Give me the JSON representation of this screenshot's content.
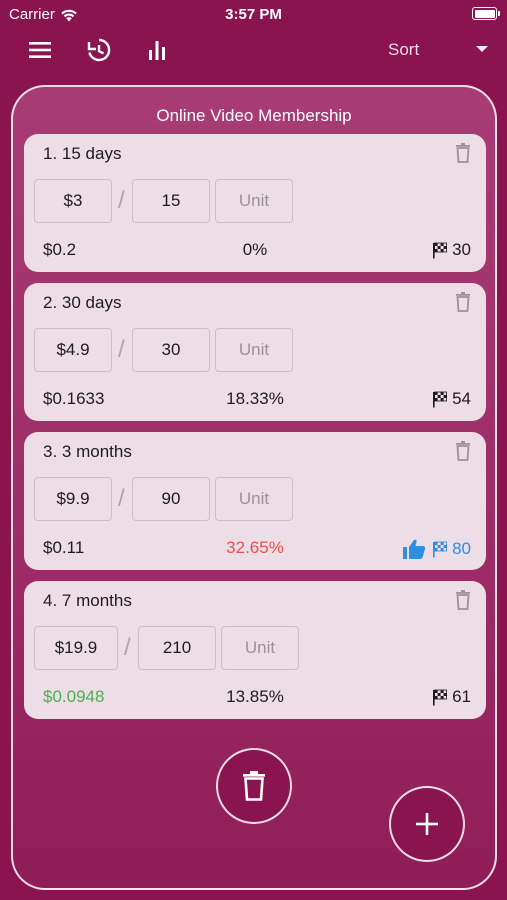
{
  "status_bar": {
    "carrier": "Carrier",
    "time": "3:57 PM"
  },
  "toolbar": {
    "menu_icon": "menu-icon",
    "history_icon": "history-icon",
    "chart_icon": "bar-chart-icon",
    "sort_label": "Sort"
  },
  "panel": {
    "title": "Online Video Membership",
    "items": [
      {
        "title": "1. 15 days",
        "price": "$3",
        "quantity": "15",
        "unit_placeholder": "Unit",
        "per_unit": "$0.2",
        "percent": "0%",
        "score": "30",
        "recommended": false
      },
      {
        "title": "2. 30 days",
        "price": "$4.9",
        "quantity": "30",
        "unit_placeholder": "Unit",
        "per_unit": "$0.1633",
        "percent": "18.33%",
        "score": "54",
        "recommended": false
      },
      {
        "title": "3. 3 months",
        "price": "$9.9",
        "quantity": "90",
        "unit_placeholder": "Unit",
        "per_unit": "$0.11",
        "percent": "32.65%",
        "score": "80",
        "recommended": true
      },
      {
        "title": "4. 7 months",
        "price": "$19.9",
        "quantity": "210",
        "unit_placeholder": "Unit",
        "per_unit": "$0.0948",
        "percent": "13.85%",
        "score": "61",
        "recommended": false
      }
    ]
  },
  "colors": {
    "background": "#8a1450",
    "highlight_red": "#e8514a",
    "highlight_blue": "#2f8ee0",
    "highlight_green": "#4caf50"
  },
  "actions": {
    "delete_all_icon": "trash-icon",
    "add_icon": "plus-icon"
  }
}
